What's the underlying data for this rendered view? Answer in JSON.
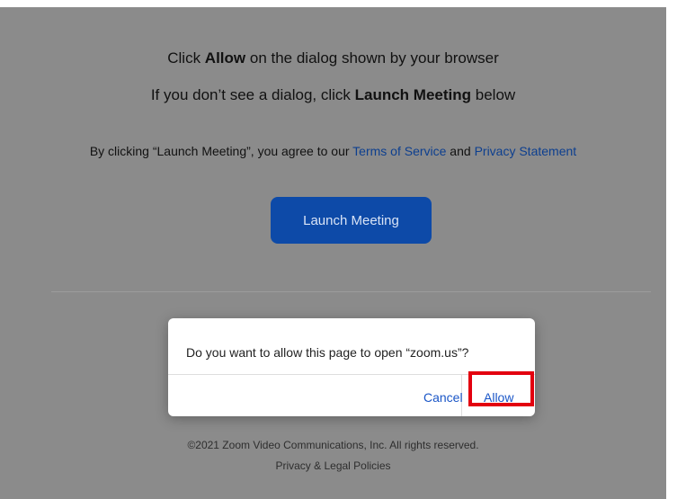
{
  "main": {
    "line1": {
      "prefix": "Click ",
      "bold": "Allow",
      "suffix": " on the dialog shown by your browser"
    },
    "line2": {
      "prefix": "If you don’t see a dialog, click ",
      "bold": "Launch Meeting",
      "suffix": " below"
    },
    "agreement": {
      "prefix": "By clicking “Launch Meeting”, you agree to our ",
      "terms_link": "Terms of Service",
      "middle": " and ",
      "privacy_link": "Privacy Statement"
    },
    "launch_button": "Launch Meeting"
  },
  "dialog": {
    "message": "Do you want to allow this page to open “zoom.us”?",
    "cancel_label": "Cancel",
    "allow_label": "Allow"
  },
  "footer": {
    "copyright": "©2021 Zoom Video Communications, Inc. All rights reserved.",
    "policies_link": "Privacy & Legal Policies"
  },
  "colors": {
    "page_background": "#8b8b8b",
    "launch_button": "#0d4aa8",
    "link": "#0d3f8f",
    "dialog_button": "#1a56c7",
    "highlight": "#e3000f"
  }
}
